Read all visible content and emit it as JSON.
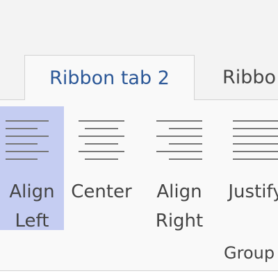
{
  "ribbon": {
    "tabs": [
      {
        "label": "Ribbon tab 2"
      },
      {
        "label": "Ribbo"
      }
    ],
    "buttons": [
      {
        "label_line1": "Align",
        "label_line2": "Left",
        "icon": "align-left-icon"
      },
      {
        "label_line1": "Center",
        "label_line2": "",
        "icon": "align-center-icon"
      },
      {
        "label_line1": "Align",
        "label_line2": "Right",
        "icon": "align-right-icon"
      },
      {
        "label_line1": "Justify",
        "label_line2": "",
        "icon": "justify-icon"
      }
    ],
    "group_label": "Group"
  },
  "colors": {
    "active_tab_text": "#2b5797",
    "selected_button_bg": "#c5cdf2",
    "ribbon_bg": "#f9f9f9",
    "border": "#d2d2d2"
  }
}
